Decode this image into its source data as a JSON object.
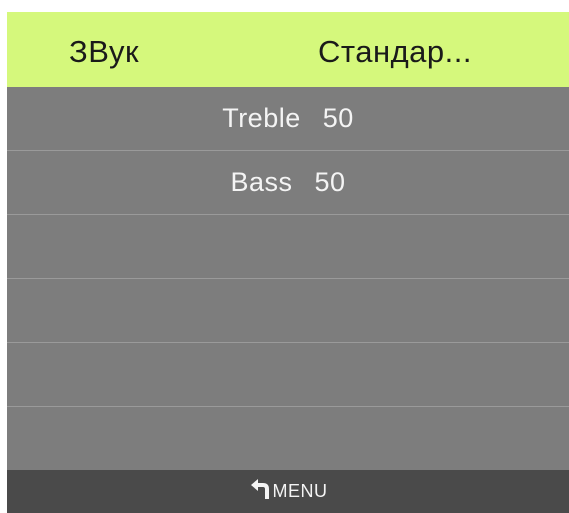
{
  "header": {
    "title": "ЗВук",
    "value": "Стандар..."
  },
  "settings": [
    {
      "label": "Treble",
      "value": "50"
    },
    {
      "label": "Bass",
      "value": "50"
    },
    {
      "label": "",
      "value": ""
    },
    {
      "label": "",
      "value": ""
    },
    {
      "label": "",
      "value": ""
    },
    {
      "label": "",
      "value": ""
    }
  ],
  "footer": {
    "icon": "back-arrow-icon",
    "label": "MENU"
  },
  "colors": {
    "header_bg": "#d5f87c",
    "list_bg": "#7d7d7d",
    "footer_bg": "#4a4a4a",
    "text_light": "#f4f4f4"
  }
}
